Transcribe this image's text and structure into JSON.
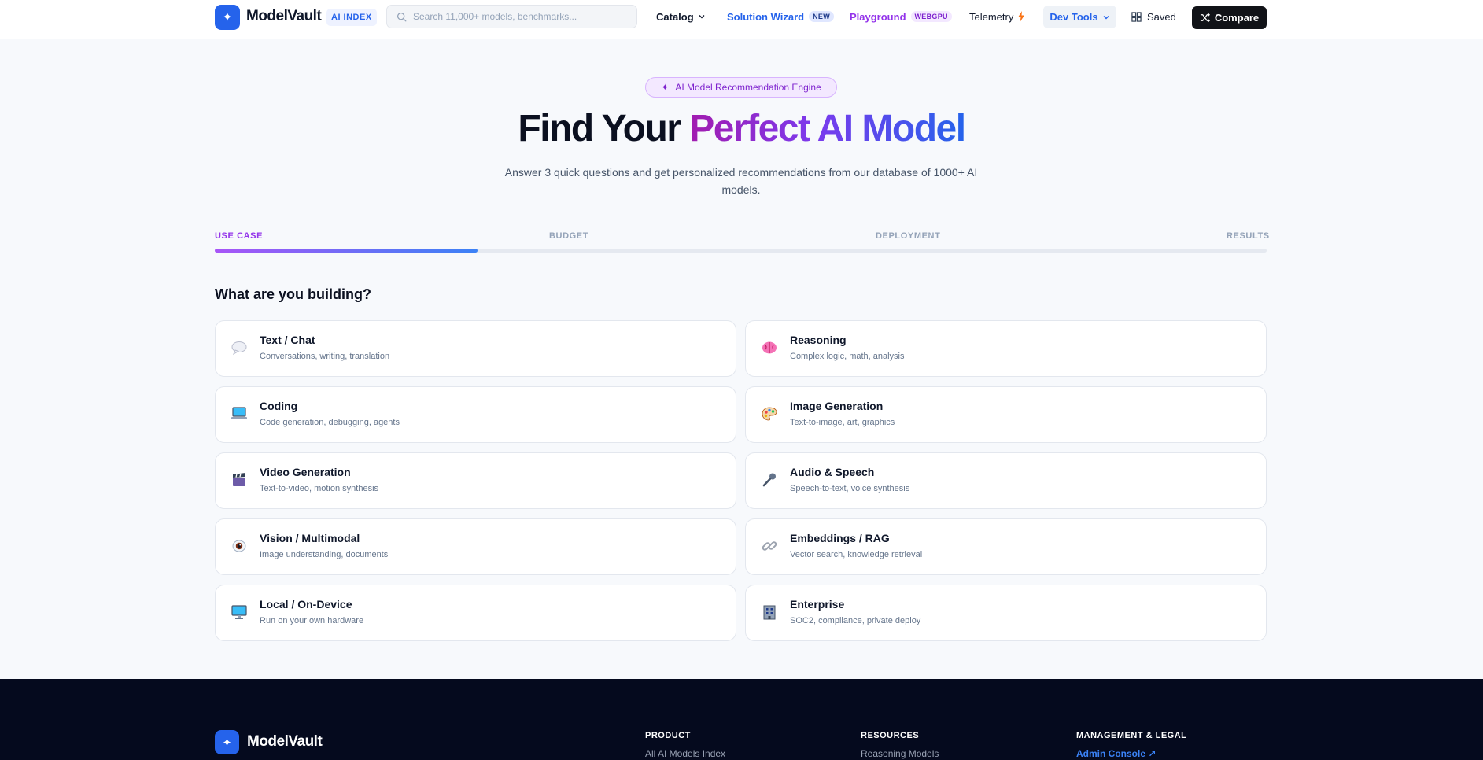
{
  "brand": {
    "name": "ModelVault",
    "tag": "AI INDEX"
  },
  "search": {
    "placeholder": "Search 11,000+ models, benchmarks..."
  },
  "nav": {
    "catalog": "Catalog",
    "wizard": "Solution Wizard",
    "wizard_badge": "NEW",
    "playground": "Playground",
    "playground_badge": "WEBGPU",
    "telemetry": "Telemetry",
    "devtools": "Dev Tools",
    "saved": "Saved",
    "compare": "Compare"
  },
  "hero": {
    "pill": "AI Model Recommendation Engine",
    "title_plain": "Find Your ",
    "title_accent": "Perfect AI Model",
    "subtitle": "Answer 3 quick questions and get personalized recommendations from our database of 1000+ AI models."
  },
  "steps": [
    "USE CASE",
    "BUDGET",
    "DEPLOYMENT",
    "RESULTS"
  ],
  "progress": {
    "fraction": 0.25
  },
  "question": "What are you building?",
  "cards": [
    {
      "title": "Text / Chat",
      "desc": "Conversations, writing, translation",
      "icon": "speech-bubble-icon"
    },
    {
      "title": "Reasoning",
      "desc": "Complex logic, math, analysis",
      "icon": "brain-icon"
    },
    {
      "title": "Coding",
      "desc": "Code generation, debugging, agents",
      "icon": "laptop-icon"
    },
    {
      "title": "Image Generation",
      "desc": "Text-to-image, art, graphics",
      "icon": "palette-icon"
    },
    {
      "title": "Video Generation",
      "desc": "Text-to-video, motion synthesis",
      "icon": "clapperboard-icon"
    },
    {
      "title": "Audio & Speech",
      "desc": "Speech-to-text, voice synthesis",
      "icon": "microphone-icon"
    },
    {
      "title": "Vision / Multimodal",
      "desc": "Image understanding, documents",
      "icon": "eye-icon"
    },
    {
      "title": "Embeddings / RAG",
      "desc": "Vector search, knowledge retrieval",
      "icon": "link-icon"
    },
    {
      "title": "Local / On-Device",
      "desc": "Run on your own hardware",
      "icon": "desktop-icon"
    },
    {
      "title": "Enterprise",
      "desc": "SOC2, compliance, private deploy",
      "icon": "office-building-icon"
    }
  ],
  "footer": {
    "brand": "ModelVault",
    "columns": [
      {
        "heading": "PRODUCT",
        "link": "All AI Models Index"
      },
      {
        "heading": "RESOURCES",
        "link": "Reasoning Models"
      },
      {
        "heading": "MANAGEMENT & LEGAL",
        "link": "Admin Console ↗"
      }
    ]
  },
  "colors": {
    "accent": "#2563eb",
    "playground": "#9333ea",
    "telemetry_icon": "#f97316",
    "dark": "#111318",
    "footer_bg": "#050a1e"
  }
}
